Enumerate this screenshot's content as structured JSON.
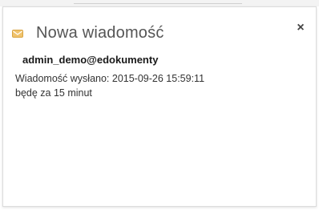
{
  "dialog": {
    "title": "Nowa wiadomość",
    "close_label": "×",
    "icon": "envelope-icon",
    "accent_color": "#f0c36d"
  },
  "message": {
    "sender": "admin_demo@edokumenty",
    "sent_prefix": "Wiadomość wysłano:",
    "sent_datetime": "2015-09-26 15:59:11",
    "sent_text": "Wiadomość wysłano: 2015-09-26 15:59:11",
    "body": "będę za 15 minut"
  }
}
